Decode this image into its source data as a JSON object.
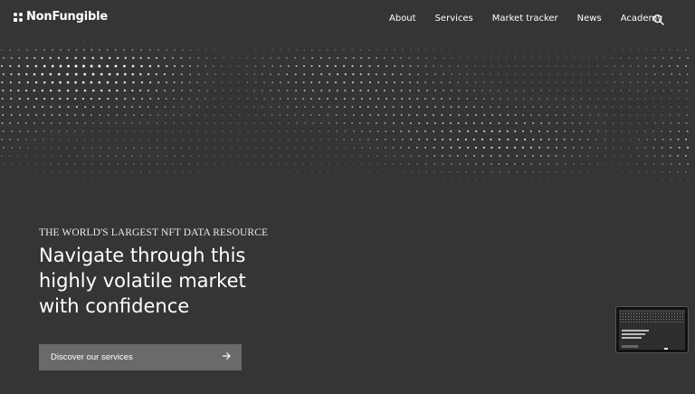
{
  "brand": {
    "name": "NonFungible",
    "logo_icon": "grid-logo-icon"
  },
  "nav": {
    "items": [
      {
        "label": "About"
      },
      {
        "label": "Services"
      },
      {
        "label": "Market tracker"
      },
      {
        "label": "News"
      },
      {
        "label": "Academy"
      }
    ],
    "search_icon": "search-icon"
  },
  "hero": {
    "eyebrow": "THE WORLD'S LARGEST NFT DATA RESOURCE",
    "headline": "Navigate through this highly volatile market with confidence",
    "cta_label": "Discover our services",
    "cta_icon": "arrow-right-icon"
  },
  "colors": {
    "background": "#353535",
    "text": "#ffffff",
    "button": "#6a6a6a"
  }
}
